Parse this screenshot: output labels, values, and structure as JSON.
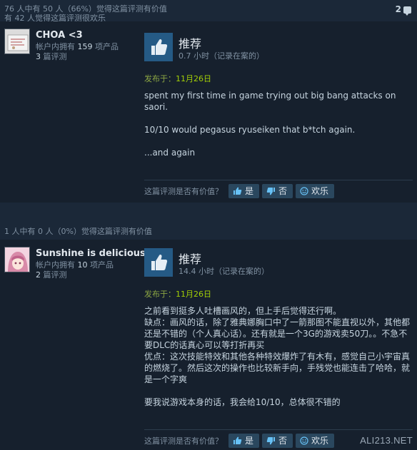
{
  "reviews": [
    {
      "helpful_line1": "76 人中有 50 人（66%）觉得这篇评测有价值",
      "helpful_line2": "有 42 人觉得这篇评测很欢乐",
      "comment_count": "2",
      "author": {
        "name": "CHOA <3",
        "products_prefix": "帐户内拥有",
        "products_count": "159",
        "products_suffix": "项产品",
        "reviews_count": "3",
        "reviews_suffix": "篇评测"
      },
      "recommendation": "推荐",
      "hours": "0.7 小时（记录在案的）",
      "posted_prefix": "发布于：",
      "posted_date": "11月26日",
      "text": "spent my first time in game trying out big bang attacks on saori.\n\n10/10 would pegasus ryuseiken that b*tch again.\n\n...and again",
      "helpful_question": "这篇评测是否有价值？",
      "yes_label": "是",
      "no_label": "否",
      "funny_label": "欢乐"
    },
    {
      "helpful_line1": "1 人中有 0 人（0%）觉得这篇评测有价值",
      "author": {
        "name": "Sunshine is delicious",
        "products_prefix": "帐户内拥有",
        "products_count": "10",
        "products_suffix": "项产品",
        "reviews_count": "2",
        "reviews_suffix": "篇评测"
      },
      "recommendation": "推荐",
      "hours": "14.4 小时（记录在案的）",
      "posted_prefix": "发布于：",
      "posted_date": "11月26日",
      "text": "之前看到挺多人吐槽画风的，但上手后觉得还行啊。\n缺点：画风的话，除了雅典娜胸口中了一箭那图不能直视以外，其他都还是不错的（个人真心话）。还有就是一个3G的游戏卖50刀。。不急不要DLC的话真心可以等打折再买\n优点：这次技能特效和其他各种特效爆炸了有木有，感觉自己小宇宙真的燃烧了。然后这次的操作也比较新手向，手残党也能连击了哈哈，就是一个字爽\n\n要我说游戏本身的话，我会给10/10，总体很不错的",
      "helpful_question": "这篇评测是否有价值？",
      "yes_label": "是",
      "no_label": "否",
      "funny_label": "欢乐"
    }
  ],
  "watermark": "ALI213.NET",
  "colors": {
    "background": "#1b2838",
    "panel": "#16202d",
    "thumb_box": "#255a85",
    "date_green": "#a3cf06",
    "button": "#2a475e"
  }
}
